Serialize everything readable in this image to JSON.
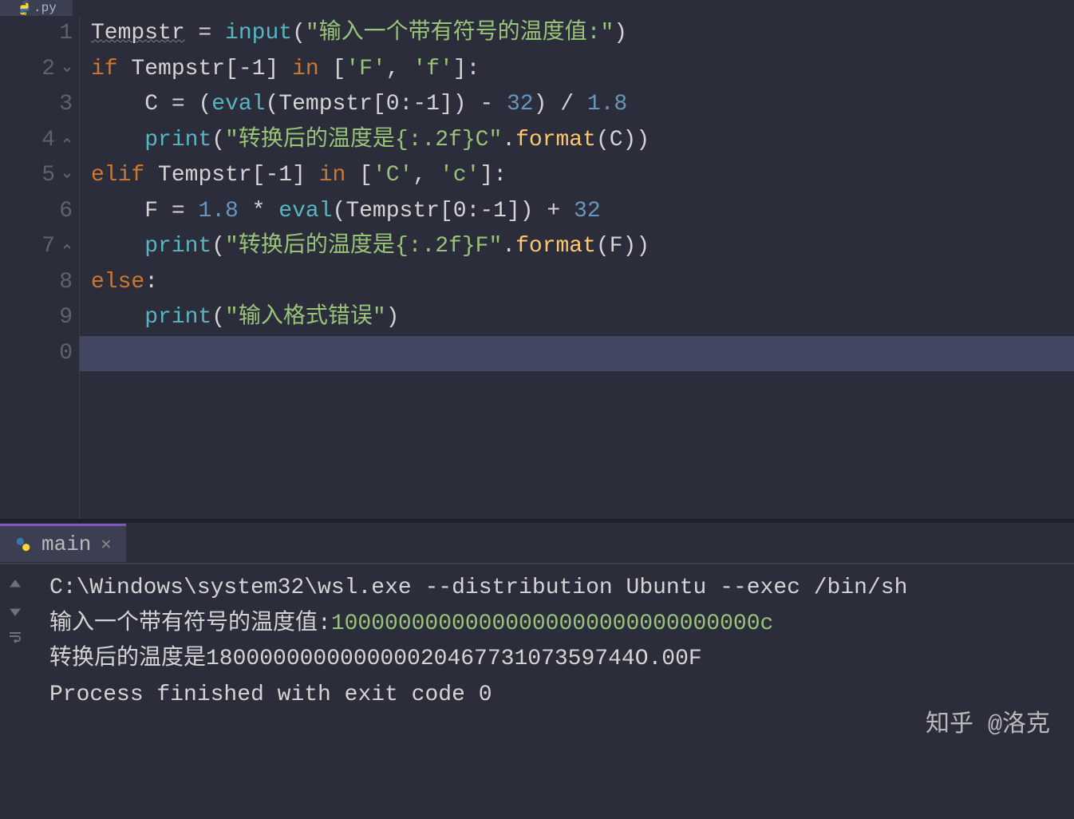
{
  "top_tab": {
    "label": ".py"
  },
  "gutter": {
    "lines": [
      "1",
      "2",
      "3",
      "4",
      "5",
      "6",
      "7",
      "8",
      "9",
      "0"
    ],
    "fold_lines": [
      2,
      4,
      5,
      7
    ]
  },
  "code": {
    "line1": {
      "var": "Tempstr",
      "assign": " = ",
      "func": "input",
      "lparen": "(",
      "str": "\"输入一个带有符号的温度值:\"",
      "rparen": ")"
    },
    "line2": {
      "kw": "if",
      "sp1": " ",
      "var": "Tempstr",
      "idx": "[-1]",
      "sp2": " ",
      "in": "in",
      "sp3": " ",
      "list": "[",
      "str1": "'F'",
      "comma": ", ",
      "str2": "'f'",
      "listend": "]",
      "colon": ":"
    },
    "line3": {
      "indent": "    ",
      "var": "C",
      "assign": " = ",
      "lparen1": "(",
      "eval": "eval",
      "lparen2": "(",
      "temp": "Tempstr",
      "idx": "[0:-1]",
      "rparen2": ")",
      "sp": " - ",
      "n32": "32",
      "rparen1": ")",
      "div": " / ",
      "n18": "1.8"
    },
    "line4": {
      "indent": "    ",
      "print": "print",
      "lparen": "(",
      "str": "\"转换后的温度是{:.2f}C\"",
      "dot": ".",
      "format": "format",
      "lparen2": "(",
      "arg": "C",
      "rparen2": ")",
      "rparen": ")"
    },
    "line5": {
      "kw": "elif",
      "sp1": " ",
      "var": "Tempstr",
      "idx": "[-1]",
      "sp2": " ",
      "in": "in",
      "sp3": " ",
      "list": "[",
      "str1": "'C'",
      "comma": ", ",
      "str2": "'c'",
      "listend": "]",
      "colon": ":"
    },
    "line6": {
      "indent": "    ",
      "var": "F",
      "assign": " = ",
      "n18": "1.8",
      "mul": " * ",
      "eval": "eval",
      "lparen": "(",
      "temp": "Tempstr",
      "idx": "[0:-1]",
      "rparen": ")",
      "plus": " + ",
      "n32": "32"
    },
    "line7": {
      "indent": "    ",
      "print": "print",
      "lparen": "(",
      "str": "\"转换后的温度是{:.2f}F\"",
      "dot": ".",
      "format": "format",
      "lparen2": "(",
      "arg": "F",
      "rparen2": ")",
      "rparen": ")"
    },
    "line8": {
      "kw": "else",
      "colon": ":"
    },
    "line9": {
      "indent": "    ",
      "print": "print",
      "lparen": "(",
      "str": "\"输入格式错误\"",
      "rparen": ")"
    }
  },
  "terminal": {
    "tab_label": "main",
    "line1": "C:\\Windows\\system32\\wsl.exe --distribution Ubuntu --exec /bin/sh",
    "line2_prompt": "输入一个带有符号的温度值:",
    "line2_input": "10000000000000000000000000000000c",
    "line3": "转换后的温度是18000000000000002046773107359744O.00F",
    "line4": "",
    "line5": "Process finished with exit code 0"
  },
  "watermark": "知乎 @洛克"
}
